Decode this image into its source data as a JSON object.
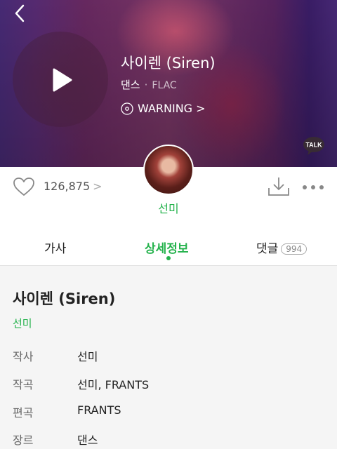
{
  "song": {
    "title": "사이렌 (Siren)",
    "genre": "댄스",
    "separator": "·",
    "format": "FLAC",
    "album": "WARNING",
    "album_chevron": ">"
  },
  "talk": {
    "label": "TALK"
  },
  "likes": {
    "count": "126,875",
    "chevron": ">"
  },
  "artist": {
    "name": "선미"
  },
  "tabs": [
    {
      "label": "가사",
      "active": false
    },
    {
      "label": "상세정보",
      "active": true
    },
    {
      "label": "댓글",
      "count": "994",
      "active": false
    }
  ],
  "detail": {
    "title": "사이렌 (Siren)",
    "artist": "선미",
    "rows": [
      {
        "label": "작사",
        "value": "선미"
      },
      {
        "label": "작곡",
        "value": "선미, FRANTS"
      },
      {
        "label": "편곡",
        "value": "FRANTS"
      },
      {
        "label": "장르",
        "value": "댄스"
      }
    ]
  },
  "colors": {
    "accent": "#24b24c",
    "text": "#222222",
    "muted": "#666666"
  },
  "icons": [
    "back-chevron-icon",
    "play-icon",
    "disc-icon",
    "kakao-talk-icon",
    "heart-icon",
    "download-icon",
    "more-icon"
  ]
}
